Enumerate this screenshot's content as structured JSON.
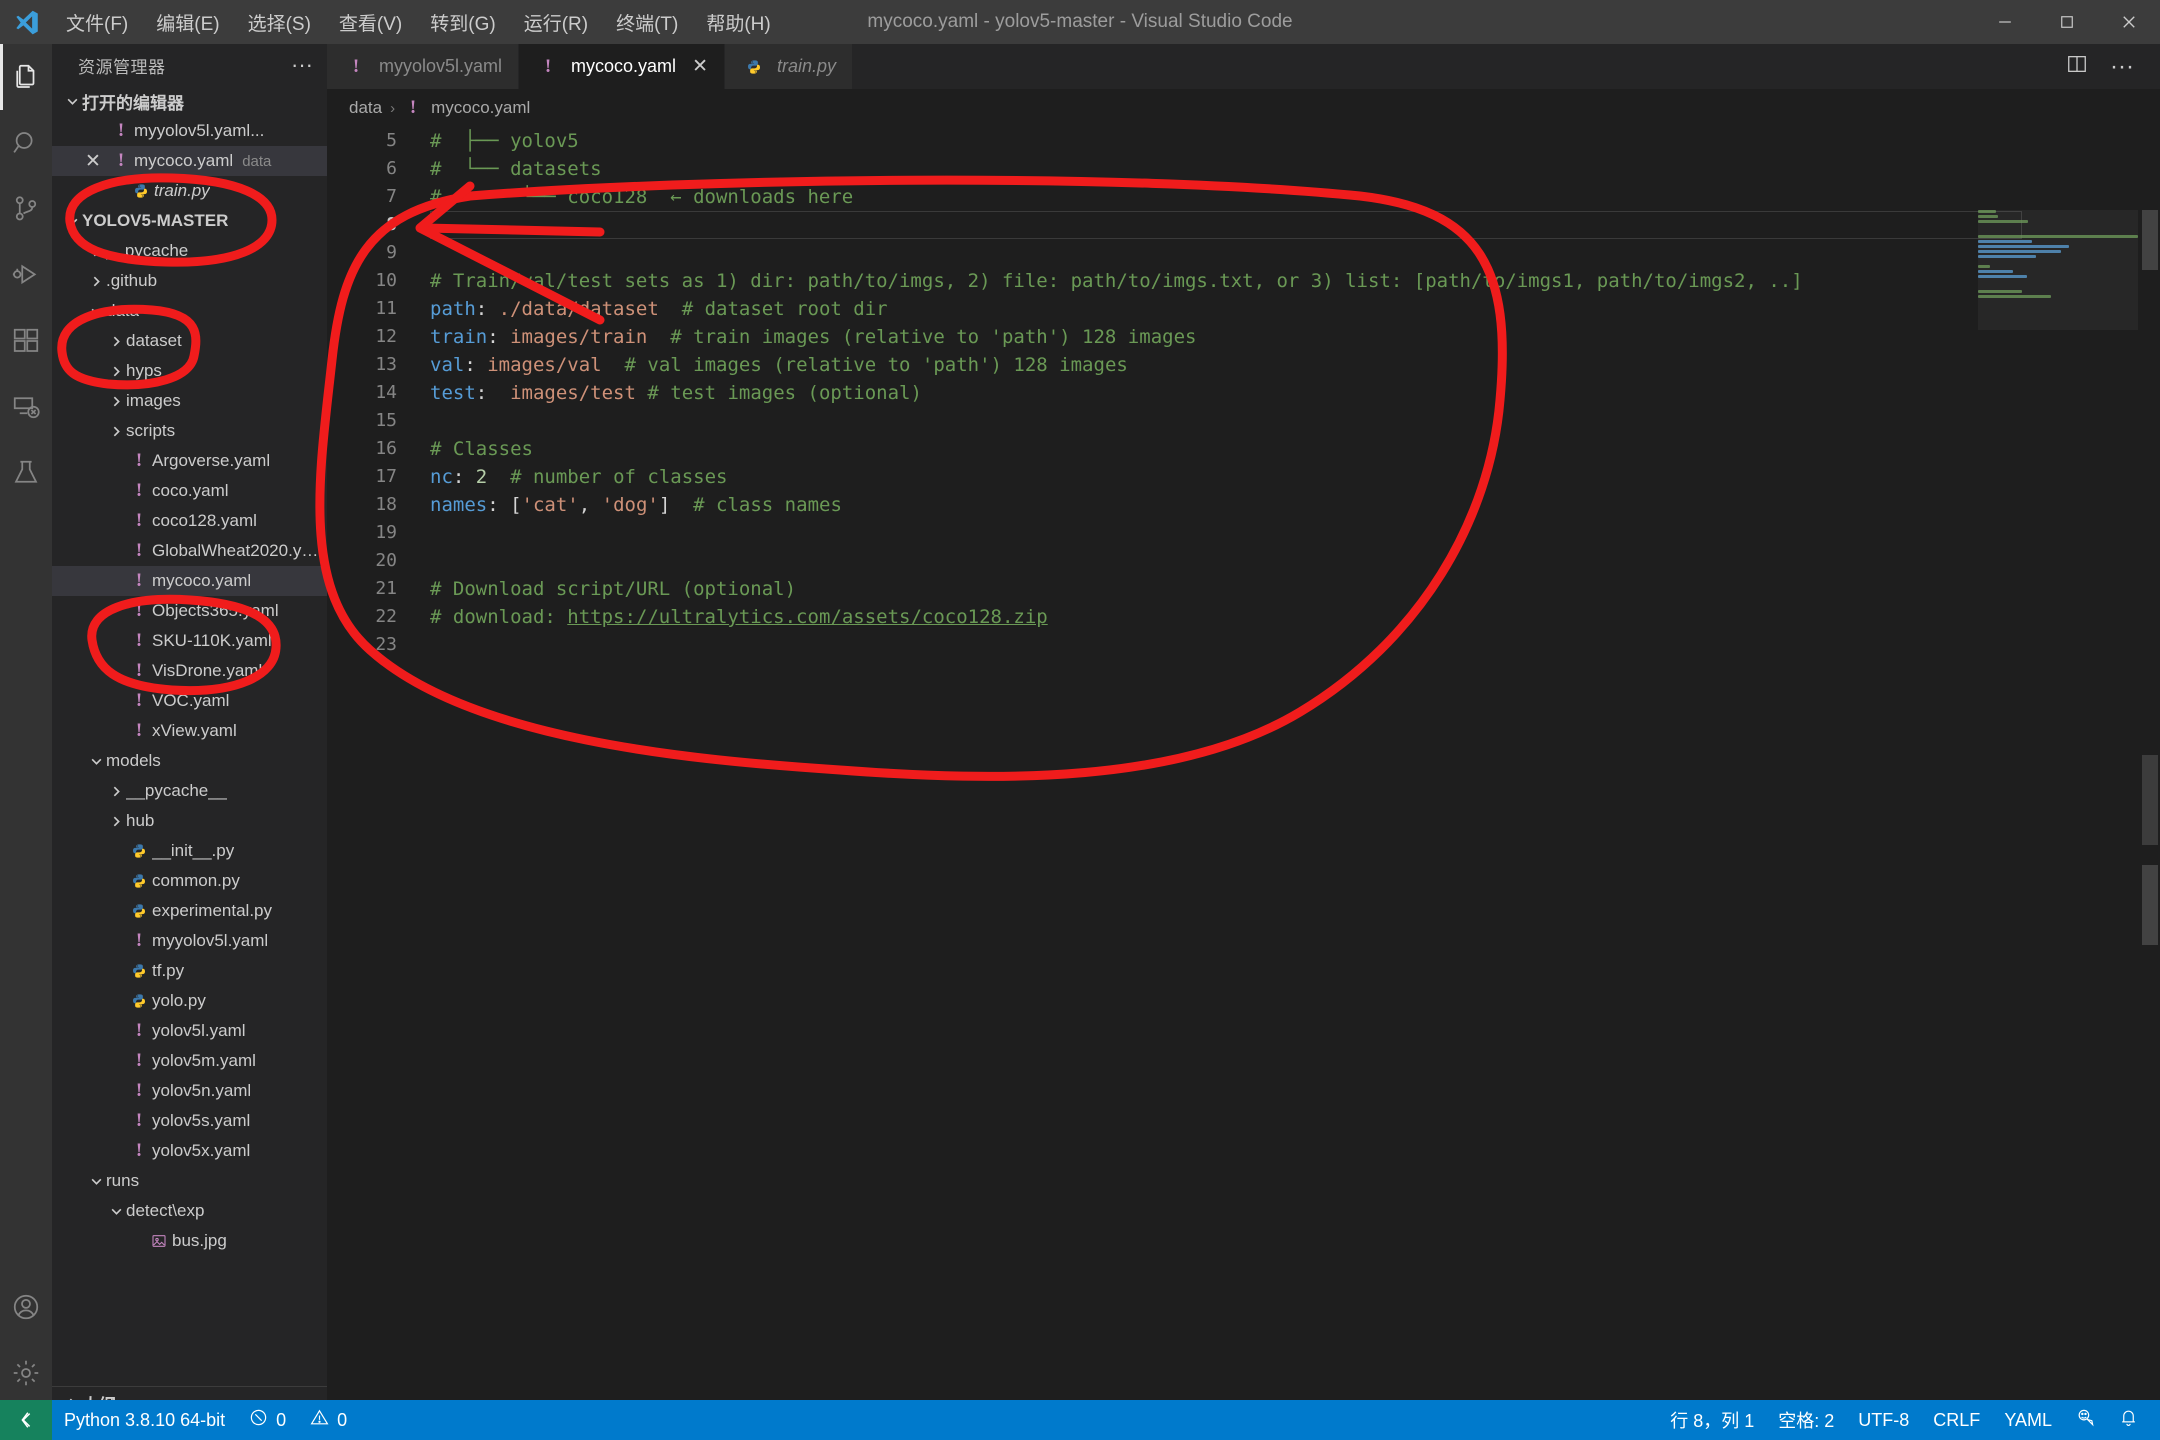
{
  "window": {
    "title": "mycoco.yaml - yolov5-master - Visual Studio Code",
    "minimize_label": "–",
    "maximize_label": "□",
    "close_label": "✕"
  },
  "menu": {
    "items": [
      {
        "label": "文件(F)",
        "name": "menu-file"
      },
      {
        "label": "编辑(E)",
        "name": "menu-edit"
      },
      {
        "label": "选择(S)",
        "name": "menu-selection"
      },
      {
        "label": "查看(V)",
        "name": "menu-view"
      },
      {
        "label": "转到(G)",
        "name": "menu-go"
      },
      {
        "label": "运行(R)",
        "name": "menu-run"
      },
      {
        "label": "终端(T)",
        "name": "menu-terminal"
      },
      {
        "label": "帮助(H)",
        "name": "menu-help"
      }
    ]
  },
  "activitybar": {
    "items": [
      {
        "icon": "files-explorer-icon",
        "active": true
      },
      {
        "icon": "search-icon",
        "active": false
      },
      {
        "icon": "source-control-icon",
        "active": false
      },
      {
        "icon": "run-and-debug-icon",
        "active": false
      },
      {
        "icon": "extensions-icon",
        "active": false
      },
      {
        "icon": "remote-explorer-icon",
        "active": false
      },
      {
        "icon": "testing-beaker-icon",
        "active": false
      }
    ],
    "bottom": [
      {
        "icon": "account-icon"
      },
      {
        "icon": "settings-gear-icon"
      }
    ]
  },
  "sidebar": {
    "title": "资源管理器",
    "more_actions": "···",
    "open_editors": {
      "label": "打开的编辑器",
      "items": [
        {
          "name": "myyolov5l.yaml...",
          "icon": "yaml-icon",
          "sub": "",
          "dirty": false,
          "active": false,
          "italic": false
        },
        {
          "name": "mycoco.yaml",
          "icon": "yaml-icon",
          "sub": "data",
          "dirty": false,
          "active": true,
          "italic": false
        },
        {
          "name": "train.py",
          "icon": "python-icon",
          "sub": "",
          "dirty": false,
          "active": false,
          "italic": true
        }
      ]
    },
    "workspace": {
      "label": "YOLOV5-MASTER",
      "tree": [
        {
          "label": "__pycache__",
          "type": "folder",
          "depth": 1,
          "expanded": false
        },
        {
          "label": ".github",
          "type": "folder",
          "depth": 1,
          "expanded": false
        },
        {
          "label": "data",
          "type": "folder",
          "depth": 1,
          "expanded": true
        },
        {
          "label": "dataset",
          "type": "folder",
          "depth": 2,
          "expanded": false
        },
        {
          "label": "hyps",
          "type": "folder",
          "depth": 2,
          "expanded": false
        },
        {
          "label": "images",
          "type": "folder",
          "depth": 2,
          "expanded": false
        },
        {
          "label": "scripts",
          "type": "folder",
          "depth": 2,
          "expanded": false
        },
        {
          "label": "Argoverse.yaml",
          "type": "yaml",
          "depth": 2
        },
        {
          "label": "coco.yaml",
          "type": "yaml",
          "depth": 2
        },
        {
          "label": "coco128.yaml",
          "type": "yaml",
          "depth": 2
        },
        {
          "label": "GlobalWheat2020.ya...",
          "type": "yaml",
          "depth": 2
        },
        {
          "label": "mycoco.yaml",
          "type": "yaml",
          "depth": 2,
          "selected": true
        },
        {
          "label": "Objects365.yaml",
          "type": "yaml",
          "depth": 2
        },
        {
          "label": "SKU-110K.yaml",
          "type": "yaml",
          "depth": 2
        },
        {
          "label": "VisDrone.yaml",
          "type": "yaml",
          "depth": 2
        },
        {
          "label": "VOC.yaml",
          "type": "yaml",
          "depth": 2
        },
        {
          "label": "xView.yaml",
          "type": "yaml",
          "depth": 2
        },
        {
          "label": "models",
          "type": "folder",
          "depth": 1,
          "expanded": true
        },
        {
          "label": "__pycache__",
          "type": "folder",
          "depth": 2,
          "expanded": false
        },
        {
          "label": "hub",
          "type": "folder",
          "depth": 2,
          "expanded": false
        },
        {
          "label": "__init__.py",
          "type": "python",
          "depth": 2
        },
        {
          "label": "common.py",
          "type": "python",
          "depth": 2
        },
        {
          "label": "experimental.py",
          "type": "python",
          "depth": 2
        },
        {
          "label": "myyolov5l.yaml",
          "type": "yaml",
          "depth": 2
        },
        {
          "label": "tf.py",
          "type": "python",
          "depth": 2
        },
        {
          "label": "yolo.py",
          "type": "python",
          "depth": 2
        },
        {
          "label": "yolov5l.yaml",
          "type": "yaml",
          "depth": 2
        },
        {
          "label": "yolov5m.yaml",
          "type": "yaml",
          "depth": 2
        },
        {
          "label": "yolov5n.yaml",
          "type": "yaml",
          "depth": 2
        },
        {
          "label": "yolov5s.yaml",
          "type": "yaml",
          "depth": 2
        },
        {
          "label": "yolov5x.yaml",
          "type": "yaml",
          "depth": 2
        },
        {
          "label": "runs",
          "type": "folder",
          "depth": 1,
          "expanded": true
        },
        {
          "label": "detect\\exp",
          "type": "folder",
          "depth": 2,
          "expanded": true
        },
        {
          "label": "bus.jpg",
          "type": "image",
          "depth": 3
        }
      ]
    },
    "outline": {
      "label": "大纲"
    }
  },
  "editor": {
    "tabs": [
      {
        "label": "myyolov5l.yaml",
        "icon": "yaml-icon",
        "active": false,
        "italic": false,
        "closable": false
      },
      {
        "label": "mycoco.yaml",
        "icon": "yaml-icon",
        "active": true,
        "italic": false,
        "closable": true,
        "close_label": "✕"
      },
      {
        "label": "train.py",
        "icon": "python-icon",
        "active": false,
        "italic": true,
        "closable": false
      }
    ],
    "actions": [
      {
        "icon": "split-editor-icon"
      },
      {
        "icon": "more-actions-icon",
        "label": "···"
      }
    ],
    "breadcrumb": {
      "folder": "data",
      "separator": "›",
      "file": "mycoco.yaml",
      "file_icon": "yaml-icon"
    },
    "first_line_number": 5,
    "current_line": 8,
    "lines": [
      {
        "n": 5,
        "tokens": [
          {
            "t": "#  ├── yolov5",
            "c": "cm"
          }
        ]
      },
      {
        "n": 6,
        "tokens": [
          {
            "t": "#  └── datasets",
            "c": "cm"
          }
        ]
      },
      {
        "n": 7,
        "tokens": [
          {
            "t": "#       └── coco128  ← downloads here",
            "c": "cm"
          }
        ]
      },
      {
        "n": 8,
        "tokens": []
      },
      {
        "n": 9,
        "tokens": []
      },
      {
        "n": 10,
        "tokens": [
          {
            "t": "# Train/val/test sets as 1) dir: path/to/imgs, 2) file: path/to/imgs.txt, or 3) list: [path/to/imgs1, path/to/imgs2, ..]",
            "c": "cm"
          }
        ]
      },
      {
        "n": 11,
        "tokens": [
          {
            "t": "path",
            "c": "key"
          },
          {
            "t": ":",
            "c": "pun"
          },
          {
            "t": " ./data/dataset",
            "c": "str"
          },
          {
            "t": "  # dataset root dir",
            "c": "cm"
          }
        ]
      },
      {
        "n": 12,
        "tokens": [
          {
            "t": "train",
            "c": "key"
          },
          {
            "t": ":",
            "c": "pun"
          },
          {
            "t": " images/train",
            "c": "str"
          },
          {
            "t": "  # train images (relative to 'path') 128 images",
            "c": "cm"
          }
        ]
      },
      {
        "n": 13,
        "tokens": [
          {
            "t": "val",
            "c": "key"
          },
          {
            "t": ":",
            "c": "pun"
          },
          {
            "t": " images/val",
            "c": "str"
          },
          {
            "t": "  # val images (relative to 'path') 128 images",
            "c": "cm"
          }
        ]
      },
      {
        "n": 14,
        "tokens": [
          {
            "t": "test",
            "c": "key"
          },
          {
            "t": ":",
            "c": "pun"
          },
          {
            "t": "  images/test",
            "c": "str"
          },
          {
            "t": " # test images (optional)",
            "c": "cm"
          }
        ]
      },
      {
        "n": 15,
        "tokens": []
      },
      {
        "n": 16,
        "tokens": [
          {
            "t": "# Classes",
            "c": "cm"
          }
        ]
      },
      {
        "n": 17,
        "tokens": [
          {
            "t": "nc",
            "c": "key"
          },
          {
            "t": ":",
            "c": "pun"
          },
          {
            "t": " 2",
            "c": "num"
          },
          {
            "t": "  # number of classes",
            "c": "cm"
          }
        ]
      },
      {
        "n": 18,
        "tokens": [
          {
            "t": "names",
            "c": "key"
          },
          {
            "t": ":",
            "c": "pun"
          },
          {
            "t": " [",
            "c": "pun"
          },
          {
            "t": "'cat'",
            "c": "str"
          },
          {
            "t": ", ",
            "c": "pun"
          },
          {
            "t": "'dog'",
            "c": "str"
          },
          {
            "t": "]",
            "c": "pun"
          },
          {
            "t": "  # class names",
            "c": "cm"
          }
        ]
      },
      {
        "n": 19,
        "tokens": []
      },
      {
        "n": 20,
        "tokens": []
      },
      {
        "n": 21,
        "tokens": [
          {
            "t": "# Download script/URL (optional)",
            "c": "cm"
          }
        ]
      },
      {
        "n": 22,
        "tokens": [
          {
            "t": "# download: ",
            "c": "cm"
          },
          {
            "t": "https://ultralytics.com/assets/coco128.zip",
            "c": "lnk"
          }
        ]
      },
      {
        "n": 23,
        "tokens": []
      }
    ]
  },
  "statusbar": {
    "remote_icon": "remote-host-icon",
    "left": [
      {
        "label": "Python 3.8.10 64-bit",
        "name": "python-interpreter"
      },
      {
        "label": "0",
        "icon": "error-icon",
        "name": "errors-count"
      },
      {
        "label": "0",
        "icon": "warning-icon",
        "name": "warnings-count"
      }
    ],
    "right": [
      {
        "label": "行 8，列 1",
        "name": "cursor-position"
      },
      {
        "label": "空格: 2",
        "name": "indentation"
      },
      {
        "label": "UTF-8",
        "name": "encoding"
      },
      {
        "label": "CRLF",
        "name": "eol"
      },
      {
        "label": "YAML",
        "name": "language-mode"
      },
      {
        "label": "",
        "icon": "feedback-smiley-icon",
        "name": "feedback"
      },
      {
        "label": "",
        "icon": "bell-icon",
        "name": "notifications"
      }
    ]
  },
  "annotations": {
    "color": "#f01c1c",
    "shapes": [
      {
        "name": "ellipse-open-editors-train-py",
        "note": "red ellipse around YOLOV5-MASTER / train.py rows"
      },
      {
        "name": "ellipse-data-folder",
        "note": "red ellipse around data folder row"
      },
      {
        "name": "ellipse-mycoco-yaml-file",
        "note": "red ellipse around mycoco.yaml in tree"
      },
      {
        "name": "big-loop-around-code",
        "note": "large red loop enclosing editor code lines 6-23"
      },
      {
        "name": "arrow-to-line-8",
        "note": "red arrow pointing at line 8 in editor"
      }
    ]
  }
}
